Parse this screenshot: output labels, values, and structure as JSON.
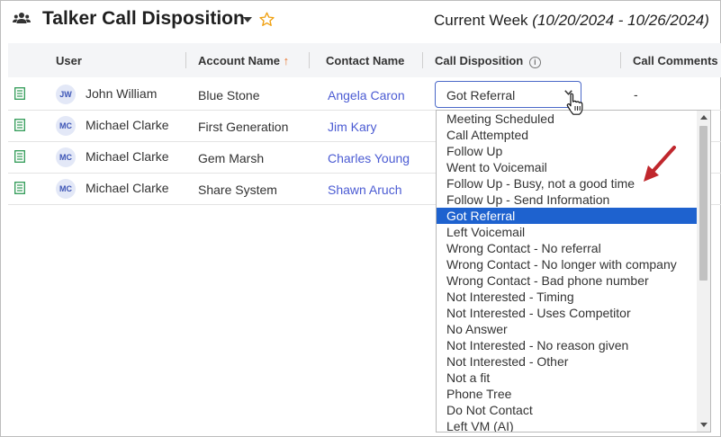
{
  "header": {
    "title": "Talker Call Disposition",
    "week_label": "Current Week",
    "week_range": "(10/20/2024 - 10/26/2024)"
  },
  "table": {
    "columns": [
      "User",
      "Account Name",
      "Contact Name",
      "Call Disposition",
      "Call Comments"
    ],
    "sort_indicator": "↑",
    "info_glyph": "i",
    "rows": [
      {
        "initials": "JW",
        "user": "John William",
        "account": "Blue Stone",
        "contact": "Angela Caron",
        "comments": "-"
      },
      {
        "initials": "MC",
        "user": "Michael Clarke",
        "account": "First Generation",
        "contact": "Jim Kary",
        "comments": ""
      },
      {
        "initials": "MC",
        "user": "Michael Clarke",
        "account": "Gem Marsh",
        "contact": "Charles Young",
        "comments": ""
      },
      {
        "initials": "MC",
        "user": "Michael Clarke",
        "account": "Share System",
        "contact": "Shawn Aruch",
        "comments": ""
      }
    ]
  },
  "disposition_select": {
    "value": "Got Referral",
    "options": [
      "Meeting Scheduled",
      "Call Attempted",
      "Follow Up",
      "Went to Voicemail",
      "Follow Up - Busy, not a good time",
      "Follow Up - Send Information",
      "Got Referral",
      "Left Voicemail",
      "Wrong Contact - No referral",
      "Wrong Contact - No longer with company",
      "Wrong Contact - Bad phone number",
      "Not Interested - Timing",
      "Not Interested - Uses Competitor",
      "No Answer",
      "Not Interested - No reason given",
      "Not Interested - Other",
      "Not a fit",
      "Phone Tree",
      "Do Not Contact",
      "Left VM (AI)"
    ],
    "selected_index": 6
  },
  "icons": {
    "header": "people-icon",
    "favorite": "star-outline-icon",
    "row": "document-icon",
    "annotation": "red-arrow-icon"
  },
  "colors": {
    "accent": "#1e62cf",
    "link": "#4b5bd3",
    "sort_arrow": "#e8742c",
    "star": "#f0a010",
    "annotation": "#c0272d",
    "row_icon": "#2e9a55"
  }
}
